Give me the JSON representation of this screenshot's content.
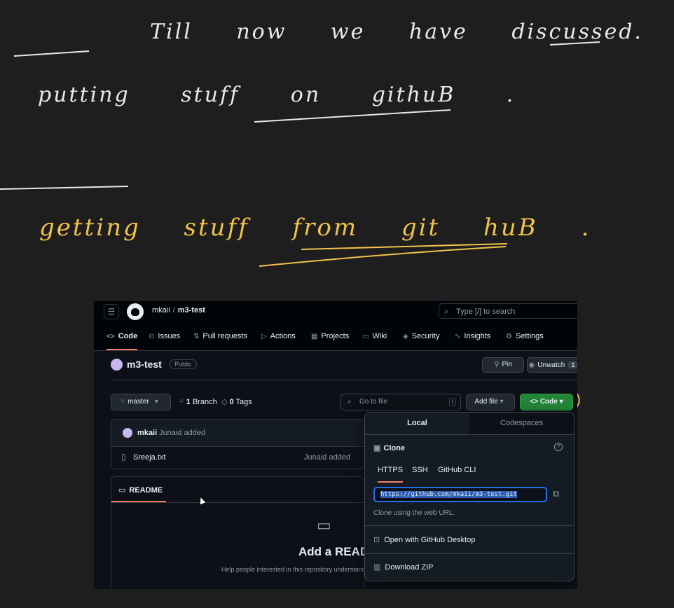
{
  "notes": {
    "line1": "Till now we have discussed.",
    "line2": "putting stuff on githuB .",
    "line3": "getting stuff from git huB ."
  },
  "colors": {
    "handwriting_white": "#e8e8e8",
    "handwriting_yellow": "#f2c24b",
    "gh_bg": "#0d1117",
    "accent_green": "#238636",
    "tab_underline": "#f78166"
  },
  "github": {
    "header": {
      "owner": "mkaii",
      "sep": "/",
      "repo": "m3-test",
      "search_placeholder": "Type [/] to search"
    },
    "tabs": [
      {
        "label": "Code",
        "icon": "code-icon"
      },
      {
        "label": "Issues",
        "icon": "issue-icon"
      },
      {
        "label": "Pull requests",
        "icon": "pull-request-icon"
      },
      {
        "label": "Actions",
        "icon": "play-icon"
      },
      {
        "label": "Projects",
        "icon": "table-icon"
      },
      {
        "label": "Wiki",
        "icon": "book-icon"
      },
      {
        "label": "Security",
        "icon": "shield-icon"
      },
      {
        "label": "Insights",
        "icon": "graph-icon"
      },
      {
        "label": "Settings",
        "icon": "gear-icon"
      }
    ],
    "repo": {
      "name": "m3-test",
      "visibility": "Public",
      "pin": "Pin",
      "unwatch": "Unwatch",
      "watch_count": "1"
    },
    "filebar": {
      "branch": "master",
      "branch_count": "1",
      "branch_label": "Branch",
      "tag_count": "0",
      "tag_label": "Tags",
      "goto_placeholder": "Go to file",
      "goto_key": "t",
      "add_file": "Add file",
      "code": "Code"
    },
    "commit": {
      "author": "mkaii",
      "message": "Junaid added"
    },
    "files": [
      {
        "name": "Sreeja.txt",
        "message": "Junaid added"
      }
    ],
    "readme": {
      "tab": "README",
      "heading": "Add a READ",
      "help": "Help people interested in this repository understand"
    },
    "popover": {
      "tab_local": "Local",
      "tab_codespaces": "Codespaces",
      "clone": "Clone",
      "clone_tabs": [
        "HTTPS",
        "SSH",
        "GitHub CLI"
      ],
      "url": "https://github.com/mkaii/m3-test.git",
      "hint": "Clone using the web URL.",
      "open_desktop": "Open with GitHub Desktop",
      "download_zip": "Download ZIP"
    }
  }
}
